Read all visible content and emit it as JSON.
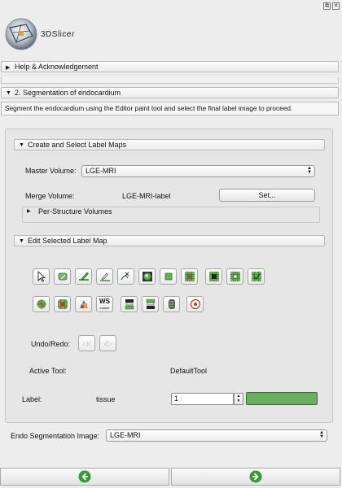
{
  "window": {
    "float_glyph": "⧉",
    "close_glyph": "✕"
  },
  "app": {
    "logo_text": "3DSlicer"
  },
  "sections": {
    "help": {
      "label": "Help & Acknowledgement",
      "collapsed": true
    },
    "step": {
      "label": "2. Segmentation of endocardium",
      "collapsed": false
    }
  },
  "description": "Segment the endocardium using the Editor paint tool and select the final label image to proceed.",
  "label_maps": {
    "header": "Create and Select Label Maps",
    "master_volume_label": "Master Volume:",
    "master_volume_value": "LGE-MRI",
    "merge_volume_label": "Merge Volume:",
    "merge_volume_value": "LGE-MRI-label",
    "set_button": "Set...",
    "per_structure_label": "Per-Structure Volumes"
  },
  "edit": {
    "header": "Edit Selected Label Map",
    "tools_row1": [
      "default-tool-icon",
      "erase-label-icon",
      "paint-icon",
      "draw-icon",
      "level-tracing-icon",
      "image-region-icon",
      "rectangle-icon",
      "threshold-icon",
      "dilate-icon",
      "erode-icon",
      "change-island-icon"
    ],
    "tools_row2": [
      "identify-islands-icon",
      "remove-islands-icon",
      "save-island-icon",
      "wand-icon",
      "change-label-icon",
      "fast-marching-icon",
      "make-model-icon",
      "grow-cut-icon"
    ],
    "ws_text": "WS",
    "ws_subtext": "marker",
    "undo_redo_label": "Undo/Redo:",
    "undo_glyph": "◁√",
    "redo_glyph": "√▷",
    "active_tool_label": "Active Tool:",
    "active_tool_value": "DefaultTool",
    "label_label": "Label:",
    "label_name": "tissue",
    "label_value": "1",
    "label_color": "#6aae5f"
  },
  "endo": {
    "label": "Endo Segmentation Image:",
    "value": "LGE-MRI"
  },
  "nav": {
    "back_icon": "back-arrow-icon",
    "next_icon": "next-arrow-icon",
    "arrow_color": "#2e9e2e"
  }
}
